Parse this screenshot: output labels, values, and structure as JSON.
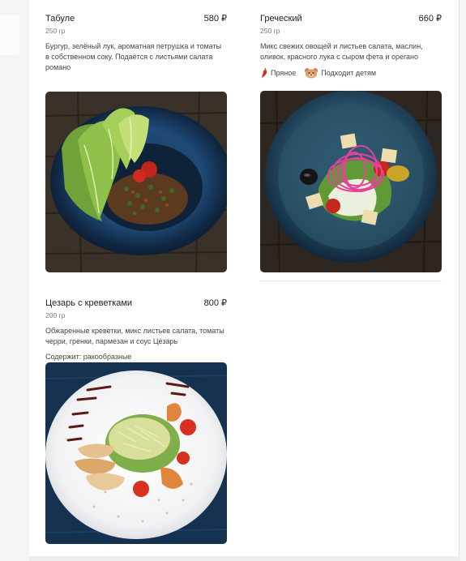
{
  "items": [
    {
      "title": "Табуле",
      "price": "580 ₽",
      "weight": "250 гр",
      "description": "Бургур, зелёный лук, ароматная петрушка и томаты в собственном соку. Подаётся с листьями салата романо"
    },
    {
      "title": "Греческий",
      "price": "660 ₽",
      "weight": "250 гр",
      "description": "Микс свежих овощей и листьев салата, маслин, оливок, красного лука с сыром фета и орегано",
      "tags": [
        {
          "icon": "chili-pepper-icon",
          "label": "Пряное"
        },
        {
          "icon": "kids-bear-icon",
          "label": "Подходит детям"
        }
      ]
    },
    {
      "title": "Цезарь с креветками",
      "price": "800 ₽",
      "weight": "200 гр",
      "description": "Обжаренные креветки, микс листьев салата, томаты черри, гренки, пармезан и соус Цезарь",
      "note": "Содержит: ракообразные"
    }
  ]
}
